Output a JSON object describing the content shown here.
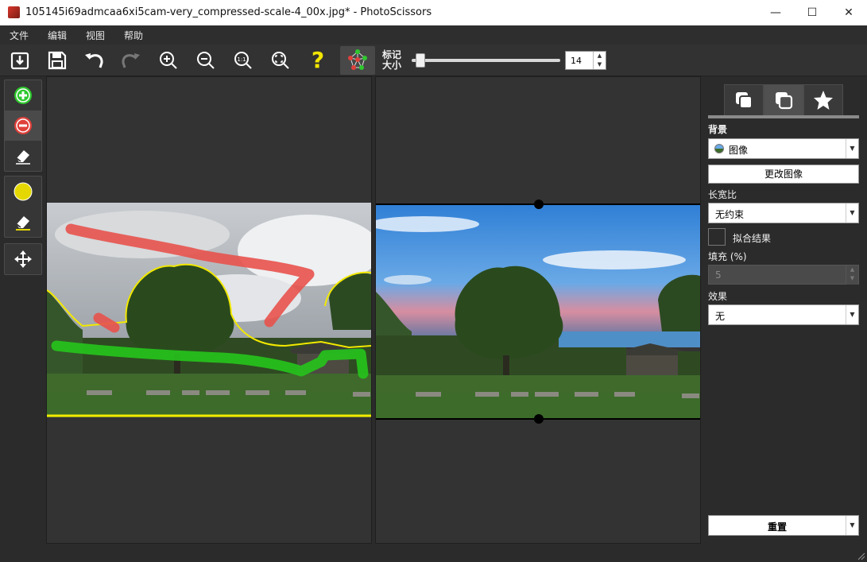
{
  "window": {
    "title": "105145i69admcaa6xi5cam-very_compressed-scale-4_00x.jpg* - PhotoScissors",
    "minimize": "—",
    "maximize": "☐",
    "close": "✕"
  },
  "menu": [
    "文件",
    "编辑",
    "视图",
    "帮助"
  ],
  "toolbar": {
    "icons": [
      "open-icon",
      "save-icon",
      "undo-icon",
      "redo-icon",
      "zoom-in-icon",
      "zoom-out-icon",
      "actual-size-icon",
      "fit-window-icon",
      "help-icon",
      "auto-segment-icon"
    ],
    "zoom_actual_text": "1:1",
    "help_text": "?",
    "marker_size_label_1": "标记",
    "marker_size_label_2": "大小",
    "marker_size_value": "14",
    "marker_size_level": 0.05
  },
  "left_tools": {
    "group1": [
      "foreground-marker-icon",
      "background-marker-icon",
      "eraser-icon"
    ],
    "group2": [
      "edge-marker-icon",
      "edge-eraser-icon"
    ],
    "group3": [
      "move-icon"
    ],
    "colors": {
      "foreground": "#2ec82e",
      "background": "#e0403a",
      "edge": "#e4d800"
    }
  },
  "right_panel": {
    "tabs": [
      "foreground-tab-icon",
      "background-tab-icon",
      "effects-tab-icon"
    ],
    "background_label": "背景",
    "background_type": "图像",
    "change_image_button": "更改图像",
    "aspect_label": "长宽比",
    "aspect_value": "无约束",
    "fit_result_label": "拟合结果",
    "fill_label": "填充 (%)",
    "fill_value": "5",
    "effect_label": "效果",
    "effect_value": "无",
    "reset_button": "重置"
  },
  "colors": {
    "accent": "#e4d800",
    "panel_bg": "#2b2b2b",
    "canvas_bg": "#333333"
  }
}
